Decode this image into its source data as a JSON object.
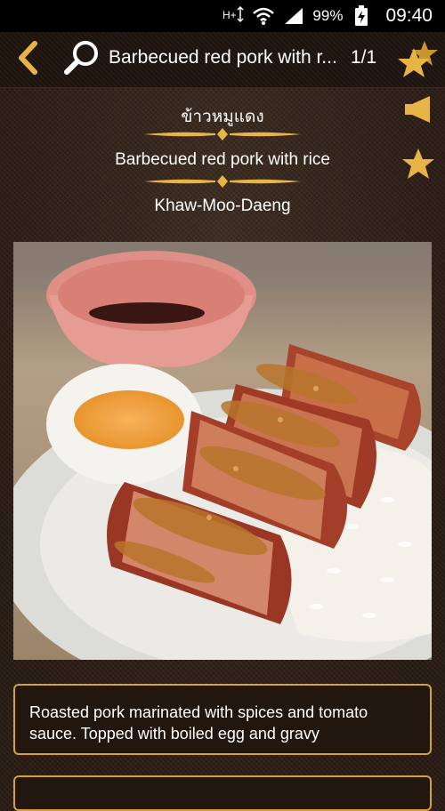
{
  "status_bar": {
    "battery_percent": "99%",
    "time": "09:40",
    "icons": [
      "hplus-data-icon",
      "wifi-icon",
      "signal-icon",
      "battery-charging-icon"
    ]
  },
  "action_bar": {
    "title": "Barbecued red pork with r...",
    "counter": "1/1",
    "icons": [
      "back-arrow-icon",
      "search-icon",
      "favorites-stars-icon"
    ]
  },
  "dish": {
    "name_thai": "ข้าวหมูแดง",
    "name_english": "Barbecued red pork with rice",
    "name_transliteration": "Khaw-Moo-Daeng",
    "description": "Roasted pork marinated with spices and tomato sauce. Topped with boiled egg and gravy"
  },
  "side_actions": {
    "icons": [
      "speaker-icon",
      "star-icon"
    ]
  },
  "colors": {
    "accent_gold": "#e8b445",
    "border_gold": "#d4a23a",
    "background_brown": "#2b1d15"
  }
}
